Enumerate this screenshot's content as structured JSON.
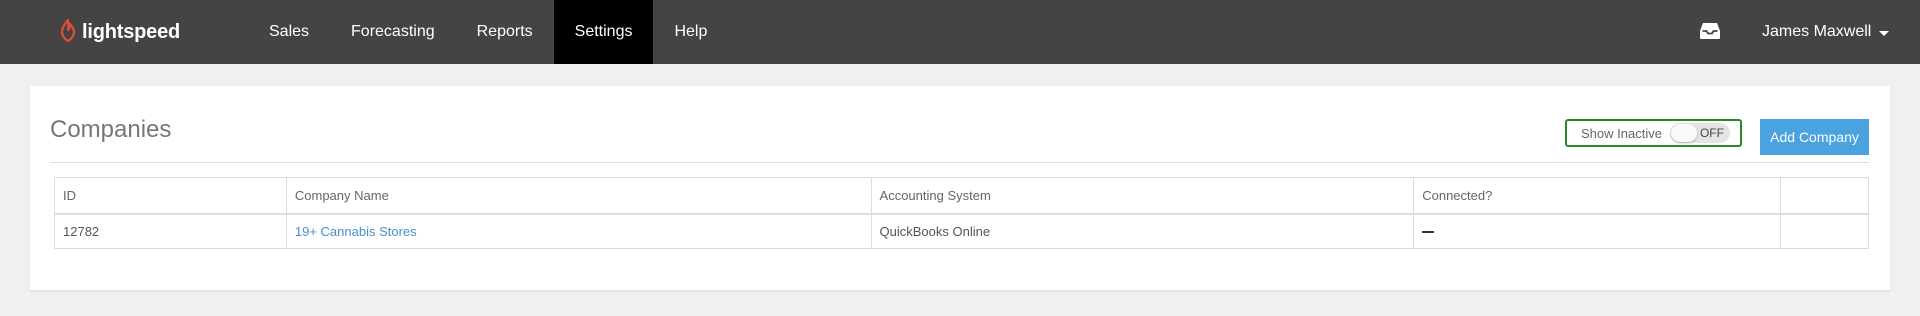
{
  "brand": {
    "name": "lightspeed",
    "accent": "#e04e39"
  },
  "nav": {
    "items": [
      {
        "label": "Sales"
      },
      {
        "label": "Forecasting"
      },
      {
        "label": "Reports"
      },
      {
        "label": "Settings",
        "active": true
      },
      {
        "label": "Help"
      }
    ]
  },
  "header_right": {
    "tray_icon": "inbox-tray-icon",
    "user_name": "James Maxwell"
  },
  "page": {
    "title": "Companies",
    "show_inactive_label": "Show Inactive",
    "show_inactive_state": "OFF",
    "add_button_label": "Add Company"
  },
  "table": {
    "columns": [
      "ID",
      "Company Name",
      "Accounting System",
      "Connected?",
      ""
    ],
    "rows": [
      {
        "id": "12782",
        "company_name": "19+ Cannabis Stores",
        "accounting_system": "QuickBooks Online",
        "connected": "not-connected-dash-icon"
      }
    ]
  },
  "colors": {
    "topbar": "#444444",
    "active_nav": "#000000",
    "primary_button": "#4aa3df",
    "link": "#4a90c8",
    "focus_outline": "#2a8a2a"
  }
}
